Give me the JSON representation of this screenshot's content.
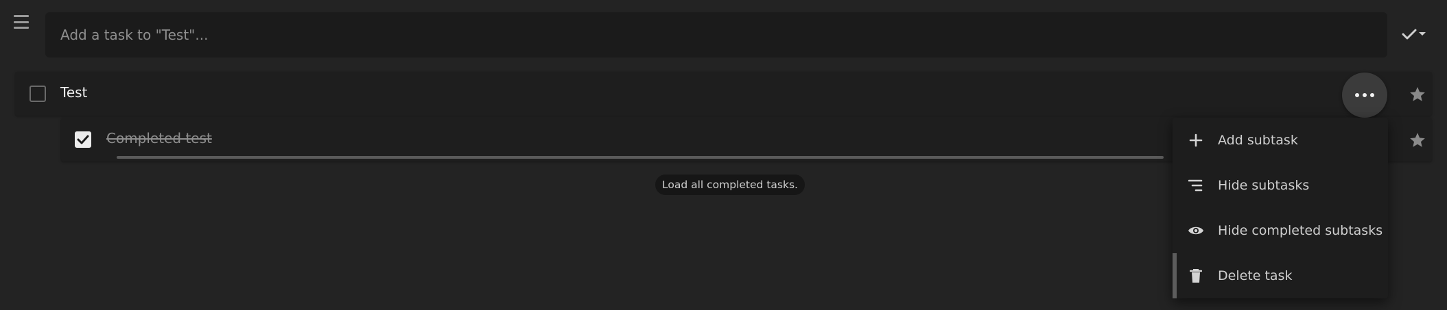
{
  "add_task": {
    "placeholder": "Add a task to \"Test\"..."
  },
  "tasks": [
    {
      "title": "Test",
      "completed": false,
      "starred": false
    },
    {
      "title": "Completed test",
      "completed": true,
      "starred": false
    }
  ],
  "load_completed_label": "Load all completed tasks.",
  "task_menu": {
    "items": [
      {
        "label": "Add subtask",
        "icon": "plus-icon"
      },
      {
        "label": "Hide subtasks",
        "icon": "subtasks-icon"
      },
      {
        "label": "Hide completed subtasks",
        "icon": "eye-icon"
      },
      {
        "label": "Delete task",
        "icon": "trash-icon"
      }
    ]
  },
  "colors": {
    "background": "#232323",
    "surface": "#1e1e1e",
    "input_bg": "#1b1b1b",
    "text": "#efefef",
    "muted_text": "#8e8e8e"
  }
}
